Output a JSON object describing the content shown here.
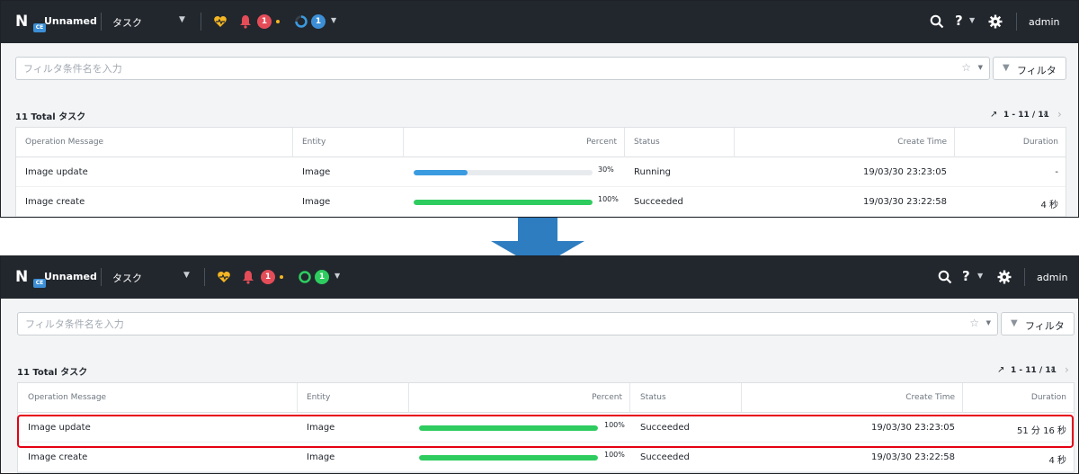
{
  "header": {
    "cluster_name": "Unnamed",
    "logo_letter": "N",
    "edition_badge": "CE",
    "menu_label": "タスク",
    "alert_count": "1",
    "help_label": "?",
    "user_label": "admin"
  },
  "filter": {
    "placeholder": "フィルタ条件名を入力",
    "button_label": "フィルタ"
  },
  "table": {
    "total_label": "11 Total タスク",
    "pager_label": "1 - 11 / 11",
    "columns": [
      "Operation Message",
      "Entity",
      "Percent",
      "Status",
      "Create Time",
      "Duration"
    ]
  },
  "before": {
    "tasks_count": "1",
    "rows": [
      {
        "message": "Image update",
        "entity": "Image",
        "percent": 30,
        "percent_label": "30%",
        "status": "Running",
        "create_time": "19/03/30 23:23:05",
        "duration": "-"
      },
      {
        "message": "Image create",
        "entity": "Image",
        "percent": 100,
        "percent_label": "100%",
        "status": "Succeeded",
        "create_time": "19/03/30 23:22:58",
        "duration": "4 秒"
      }
    ]
  },
  "after": {
    "tasks_count": "1",
    "rows": [
      {
        "message": "Image update",
        "entity": "Image",
        "percent": 100,
        "percent_label": "100%",
        "status": "Succeeded",
        "create_time": "19/03/30 23:23:05",
        "duration": "51 分 16 秒"
      },
      {
        "message": "Image create",
        "entity": "Image",
        "percent": 100,
        "percent_label": "100%",
        "status": "Succeeded",
        "create_time": "19/03/30 23:22:58",
        "duration": "4 秒"
      }
    ]
  },
  "colors": {
    "topbar": "#22272e",
    "progress_running": "#3a9be0",
    "progress_done": "#2ecc5f",
    "alert_badge": "#e44d58",
    "task_badge_running": "#3c8fd6",
    "task_badge_done": "#2ecc5f",
    "highlight": "#e60012",
    "flow_arrow": "#2e7dc0"
  },
  "icons": [
    "heart-icon",
    "bell-icon",
    "search-icon",
    "help-icon",
    "gear-icon",
    "star-icon",
    "funnel-icon",
    "export-icon",
    "chevron-left-icon",
    "chevron-right-icon"
  ]
}
